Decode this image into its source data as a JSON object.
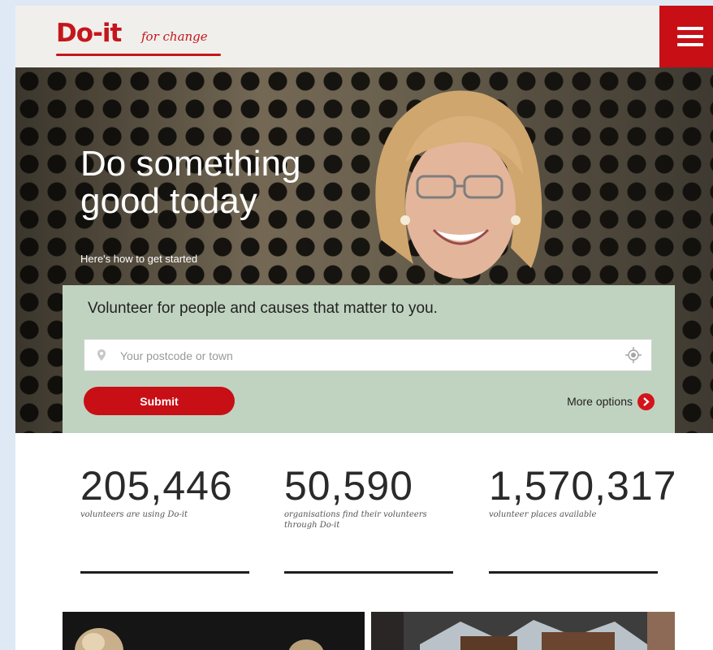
{
  "header": {
    "logo_main": "Do-it",
    "logo_tagline": "for change",
    "menu_icon": "hamburger-icon"
  },
  "hero": {
    "title_line1": "Do something",
    "title_line2": "good today",
    "subtitle": "Here's how to get started"
  },
  "search": {
    "heading": "Volunteer for people and causes that matter to you.",
    "placeholder": "Your postcode or town",
    "pin_icon": "map-pin-icon",
    "locate_icon": "locate-icon",
    "submit_label": "Submit",
    "more_options_label": "More options",
    "more_icon": "chevron-right-icon"
  },
  "stats": [
    {
      "value": "205,446",
      "label": "volunteers are using Do-it"
    },
    {
      "value": "50,590",
      "label": "organisations find their volunteers through Do-it"
    },
    {
      "value": "1,570,317",
      "label": "volunteer places available"
    }
  ],
  "colors": {
    "brand_red": "#c80f16",
    "panel_green": "#c0d3c0",
    "header_bg": "#f1efec"
  }
}
